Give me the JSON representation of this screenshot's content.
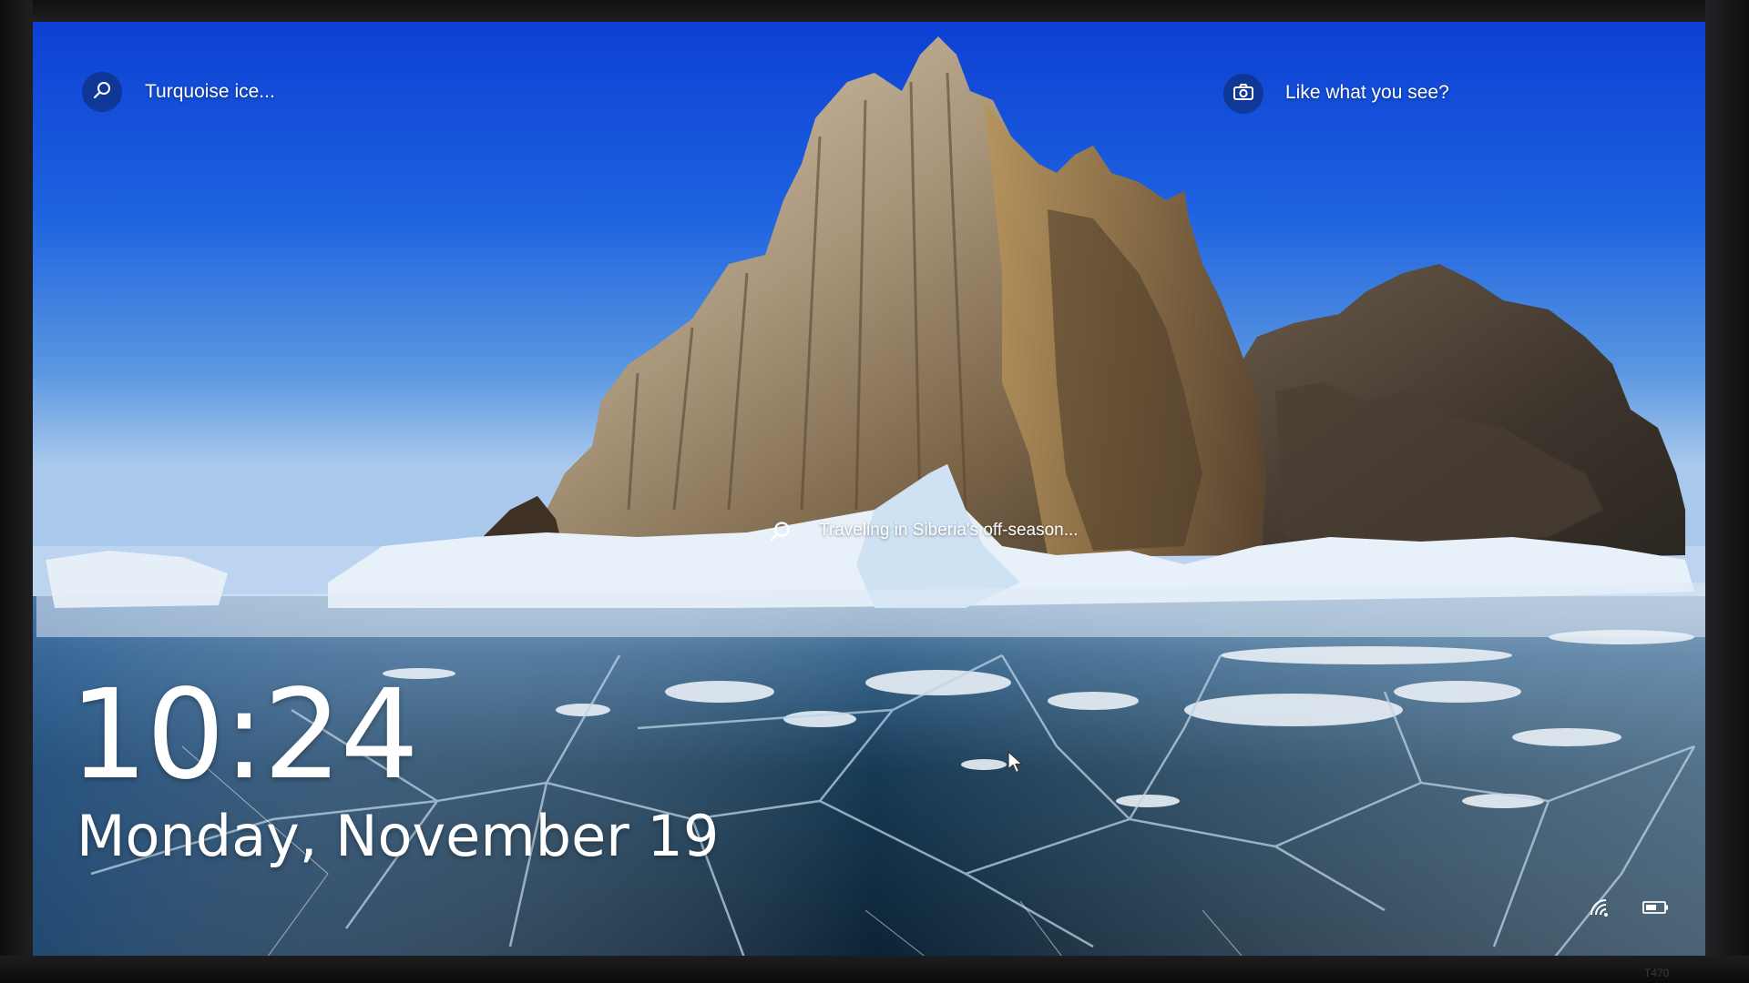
{
  "lock_screen": {
    "spotlight_title": "Turquoise ice...",
    "like_prompt": "Like what you see?",
    "image_caption": "Traveling in Siberia's off-season...",
    "time": "10:24",
    "date": "Monday, November 19"
  },
  "bezel": {
    "brand_mark": "T470"
  },
  "icons": {
    "spotlight_search": "search-icon",
    "like_camera": "camera-icon",
    "caption_search": "search-icon",
    "network": "network-icon",
    "battery": "battery-icon",
    "cursor": "mouse-cursor-icon"
  },
  "colors": {
    "sky_top": "#0a3fd0",
    "sky_horizon": "#8fb8e6",
    "ice_dark": "#0e2a3a",
    "snow": "#e8f1fa",
    "rock": "#8a7660",
    "text": "#ffffff"
  }
}
